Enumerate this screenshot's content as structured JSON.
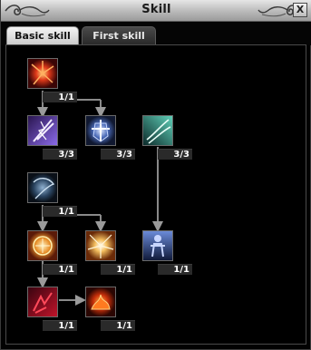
{
  "window": {
    "title": "Skill",
    "close_label": "X"
  },
  "tabs": [
    {
      "label": "Basic skill",
      "active": true
    },
    {
      "label": "First skill",
      "active": false
    }
  ],
  "skills": [
    {
      "id": "skill-1",
      "icon": "fire-burst-icon",
      "level": "1/1",
      "color": "#c8281a"
    },
    {
      "id": "skill-2",
      "icon": "lightning-sword-icon",
      "level": "3/3",
      "color": "#6a4bd8"
    },
    {
      "id": "skill-3",
      "icon": "armor-blue-icon",
      "level": "3/3",
      "color": "#4a78c8"
    },
    {
      "id": "skill-4",
      "icon": "wind-slash-icon",
      "level": "3/3",
      "color": "#3fb49a"
    },
    {
      "id": "skill-5",
      "icon": "dark-armor-icon",
      "level": "1/1",
      "color": "#2e4b6a"
    },
    {
      "id": "skill-6",
      "icon": "golden-shield-icon",
      "level": "1/1",
      "color": "#e8a93a"
    },
    {
      "id": "skill-7",
      "icon": "golden-burst-icon",
      "level": "1/1",
      "color": "#f0b04a"
    },
    {
      "id": "skill-8",
      "icon": "warrior-figure-icon",
      "level": "1/1",
      "color": "#3c5ea8"
    },
    {
      "id": "skill-9",
      "icon": "red-claw-icon",
      "level": "1/1",
      "color": "#b8122a"
    },
    {
      "id": "skill-10",
      "icon": "flame-beast-icon",
      "level": "1/1",
      "color": "#d43a10"
    }
  ]
}
